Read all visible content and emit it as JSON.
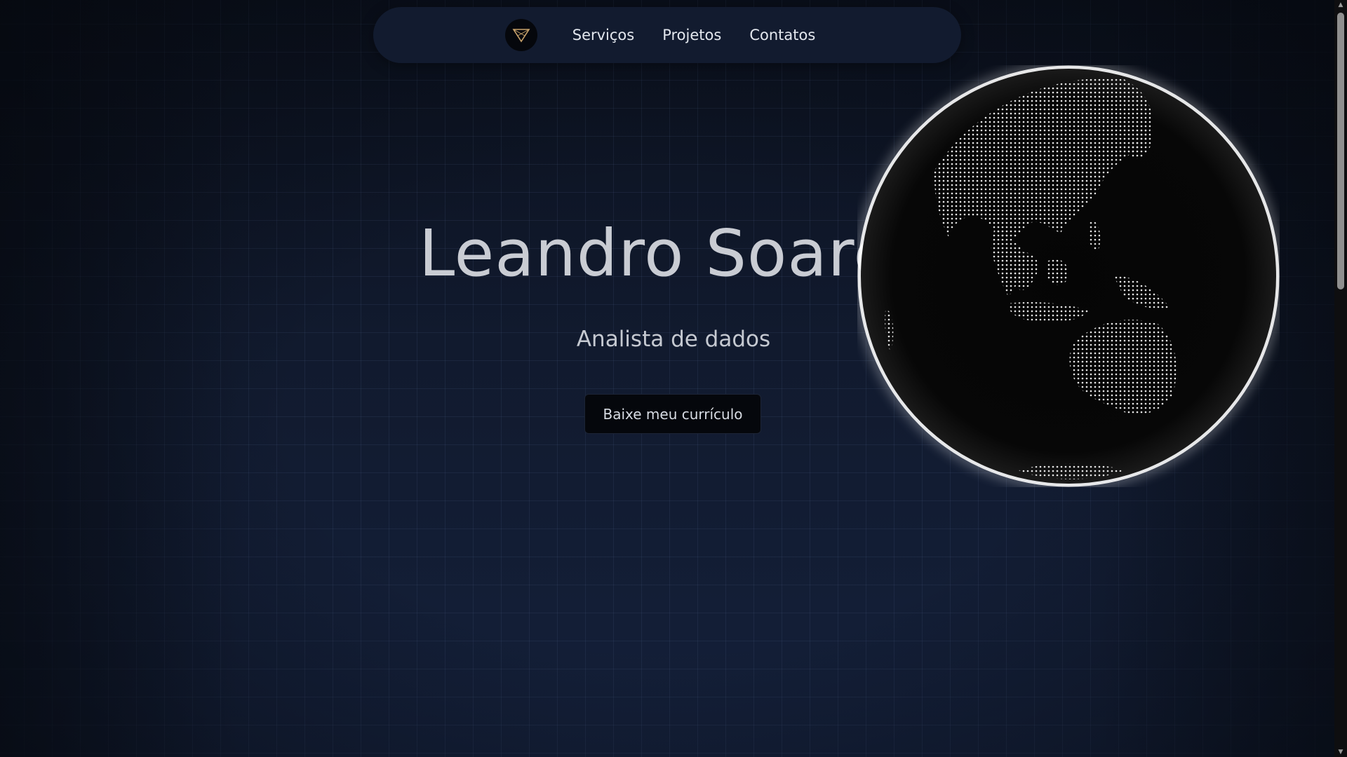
{
  "nav": {
    "logo_icon": "triangle-logo-icon",
    "links": [
      "Serviços",
      "Projetos",
      "Contatos"
    ]
  },
  "hero": {
    "name": "Leandro Soares",
    "role": "Analista de dados",
    "cv_button": "Baixe meu currículo"
  },
  "globe": {
    "icon": "dotted-globe-icon",
    "glow_color": "#ffffff"
  },
  "colors": {
    "background": "#0f1628",
    "navbar": "#121b2f",
    "button": "#05070c",
    "accent_logo": "#c9a36b"
  }
}
